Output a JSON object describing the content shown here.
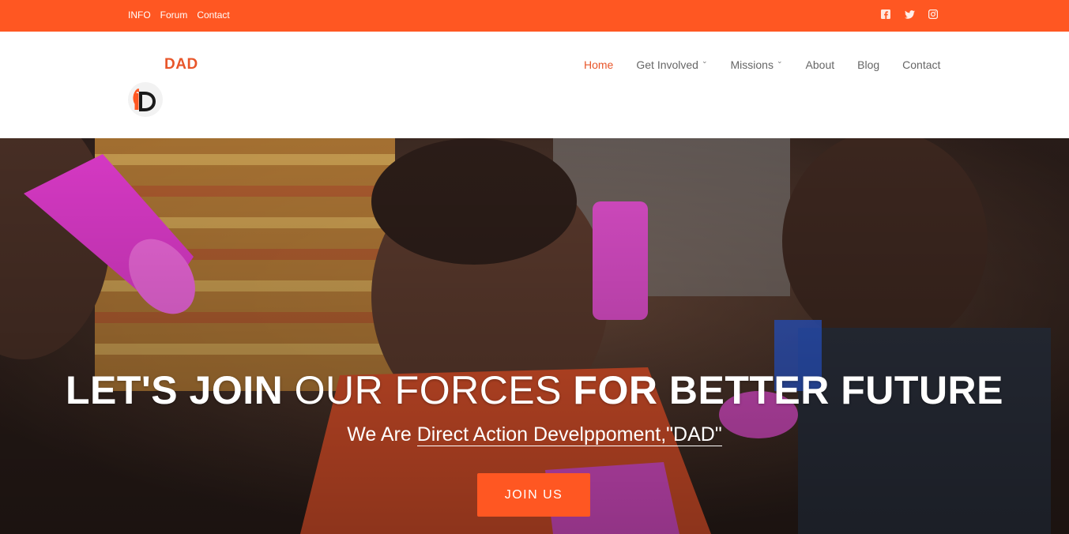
{
  "topbar": {
    "links": [
      "INFO",
      "Forum",
      "Contact"
    ],
    "social_icons": [
      "facebook-icon",
      "twitter-icon",
      "instagram-icon"
    ],
    "color": "#ff5722"
  },
  "header": {
    "logo_text": "DAD",
    "nav": [
      {
        "label": "Home",
        "active": true
      },
      {
        "label": "Get Involved",
        "dropdown": true
      },
      {
        "label": "Missions",
        "dropdown": true
      },
      {
        "label": "About"
      },
      {
        "label": "Blog"
      },
      {
        "label": "Contact"
      }
    ]
  },
  "hero": {
    "title_part1": "LET'S JOIN",
    "title_part2": "OUR FORCES",
    "title_part3": "FOR BETTER FUTURE",
    "subtitle_prefix": "We Are",
    "subtitle_underlined": "Direct Action Develppoment,\"DAD\"",
    "button_label": "JOIN US"
  },
  "colors": {
    "accent": "#ff5722",
    "brand_text": "#e8562a"
  }
}
